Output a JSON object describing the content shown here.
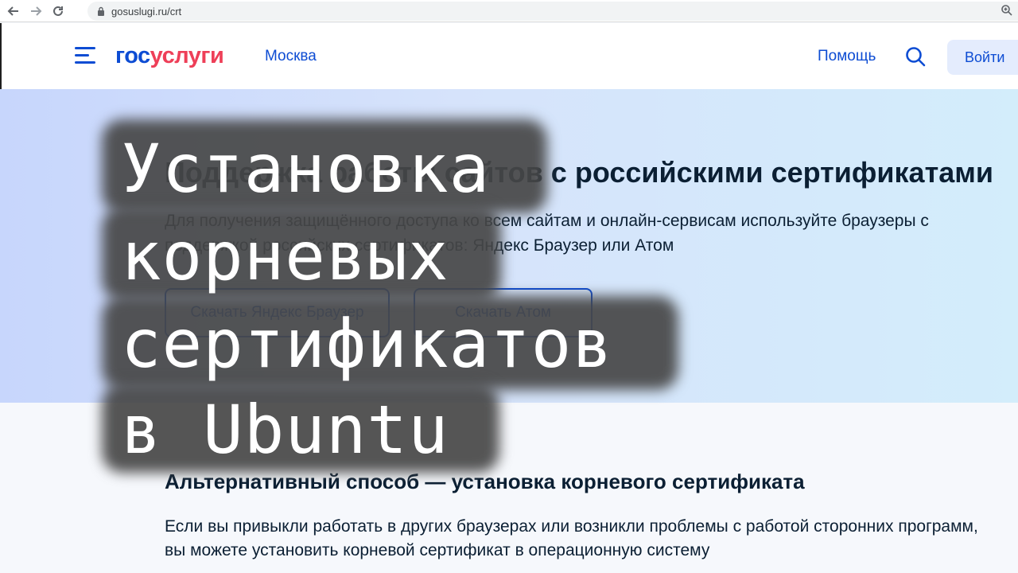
{
  "browser": {
    "url": "gosuslugi.ru/crt"
  },
  "header": {
    "logo_part1": "гос",
    "logo_part2": "услуги",
    "city": "Москва",
    "help_label": "Помощь",
    "login_label": "Войти"
  },
  "hero": {
    "title": "Поддержка работы сайтов с российскими сертификатами",
    "text": "Для получения защищённого доступа ко всем сайтам и онлайн-сервисам используйте браузеры с поддержкой российских сертификатов: Яндекс Браузер или Атом",
    "btn_yandex": "Скачать Яндекс Браузер",
    "btn_atom": "Скачать Атом"
  },
  "alternative": {
    "title": "Альтернативный способ — установка корневого сертификата",
    "text_line1": "Если вы привыкли работать в других браузерах или возникли проблемы с работой сторонних программ,",
    "text_line2": "вы можете установить корневой сертификат в операционную систему"
  },
  "overlay": {
    "line1": "Установка",
    "line2": "корневых",
    "line3": "сертификатов",
    "line4": "в Ubuntu"
  },
  "colors": {
    "brand_blue": "#0d4cd3",
    "brand_red": "#ee3f58",
    "text_dark": "#0b1f33",
    "login_bg": "#e4ecfd"
  }
}
